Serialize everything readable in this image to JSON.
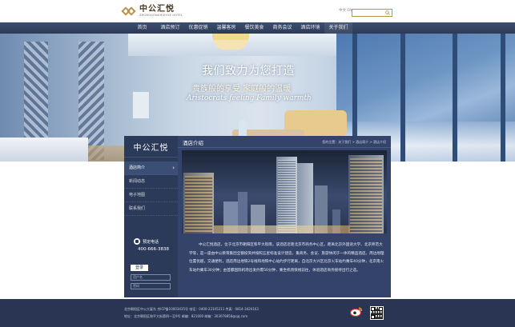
{
  "header": {
    "logo_cn": "中公汇悦",
    "logo_en": "ZHONGGONGHUIYUE HOTEL",
    "lang": "中文 EN"
  },
  "nav": {
    "items": [
      "首页",
      "酒店预订",
      "优惠促销",
      "温馨客房",
      "餐饮美食",
      "商务会议",
      "酒店环境",
      "关于我们"
    ]
  },
  "banner": {
    "slogan_main": "我们致力为您打造",
    "slogan_sub": "贵族般的享受 家庭般的温暖",
    "slogan_en": "Aristocrats feeling  Family warmth"
  },
  "sidebar": {
    "logo": "中公汇悦",
    "items": [
      "酒店简介",
      "新闻动态",
      "电子地图",
      "联系我们"
    ],
    "phone_label": "预定电话",
    "phone": "400-666-3838",
    "login_label": "登录",
    "username_placeholder": "用户名",
    "password_placeholder": "密码"
  },
  "panel": {
    "title": "酒店介绍",
    "breadcrumb": "您的位置：关于我们 > 酒店简介 > 酒店介绍",
    "text": "中公汇悦酒店，位于北京市朝阳区和平大街南，该酒店近距北京市商务中心区，距离北京外国语大学、北京师范大学等，是一座由中公教育集团全额投资并按照五星标准设计建造，集商务、会议、旅游休闲于一体的精品酒店。周边地理位置优越，交通便利，酒店周边地铁2号线和地铁中心站约步行距离，自北京大兴区北京火车站约乘车40分钟，北京南火车站约乘车30分钟；由首都国际机场出发约需50分钟，乘坐机场快线前往，体验酒店商务接待出行之选。"
  },
  "footer": {
    "line1": "北京朝阳区中公大厦东   京ICP备10003435号   电话：0400-22345211   传真：0814-3424163",
    "line2": "地址：北京朝阳区和平大街第四一至9号   邮编：821000   邮箱：303078858@qq.com"
  }
}
